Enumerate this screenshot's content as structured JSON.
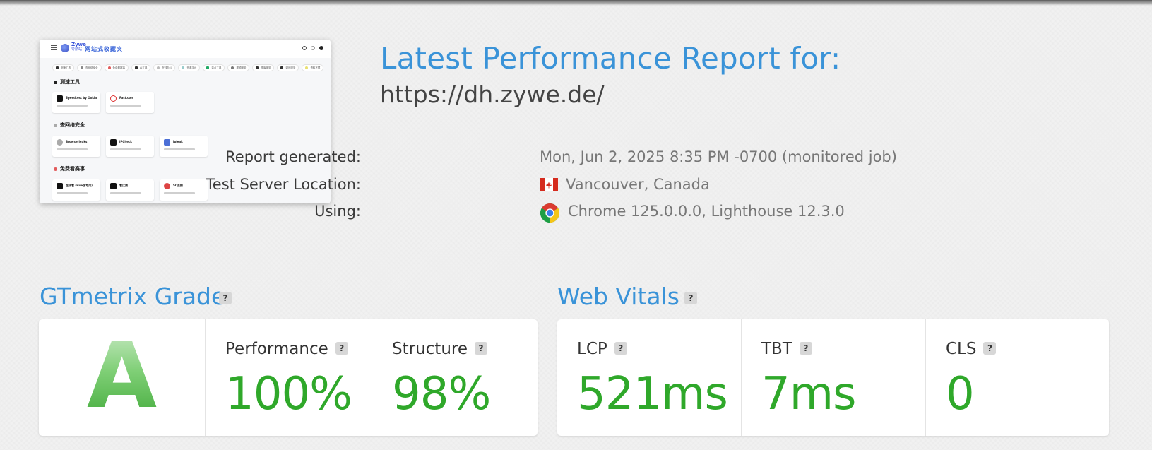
{
  "thumbnail": {
    "brand_top": "Zywe",
    "brand_bottom": "导航站",
    "site_title": "网站式收藏夹",
    "chips": [
      "测速工具",
      "查网络安全",
      "免费看赛事",
      "AI工具",
      "在线办公",
      "开源平台",
      "站点工具",
      "视频服务",
      "图库服务",
      "娱乐服务",
      "资料下载"
    ],
    "sections": [
      {
        "title": "测速工具",
        "cards": [
          {
            "name": "Speedtest by Ookla"
          },
          {
            "name": "Fast.com"
          }
        ]
      },
      {
        "title": "查网络安全",
        "cards": [
          {
            "name": "Browserleaks"
          },
          {
            "name": "IPCheck"
          },
          {
            "name": "Ipleak"
          }
        ]
      },
      {
        "title": "免费看赛事",
        "cards": [
          {
            "name": "在线看 (Hue版专用)"
          },
          {
            "name": "看比赛"
          },
          {
            "name": "SC直播"
          }
        ]
      }
    ]
  },
  "header": {
    "title": "Latest Performance Report for:",
    "url": "https://dh.zywe.de/"
  },
  "meta": {
    "generated_label": "Report generated:",
    "generated_value": "Mon, Jun 2, 2025 8:35 PM -0700 (monitored job)",
    "location_label": "Test Server Location:",
    "location_value": "Vancouver, Canada",
    "location_flag_icon": "canada-flag-icon",
    "using_label": "Using:",
    "using_value": "Chrome 125.0.0.0, Lighthouse 12.3.0",
    "using_icon": "chrome-icon"
  },
  "gtmetrix": {
    "title": "GTmetrix Grade",
    "help": "?",
    "grade": "A",
    "performance_label": "Performance",
    "performance_value": "100%",
    "structure_label": "Structure",
    "structure_value": "98%"
  },
  "web_vitals": {
    "title": "Web Vitals",
    "help": "?",
    "lcp_label": "LCP",
    "lcp_value": "521ms",
    "tbt_label": "TBT",
    "tbt_value": "7ms",
    "cls_label": "CLS",
    "cls_value": "0"
  },
  "colors": {
    "accent_blue": "#3a93d8",
    "good_green": "#2fa82a",
    "background": "#f1f1f1"
  }
}
